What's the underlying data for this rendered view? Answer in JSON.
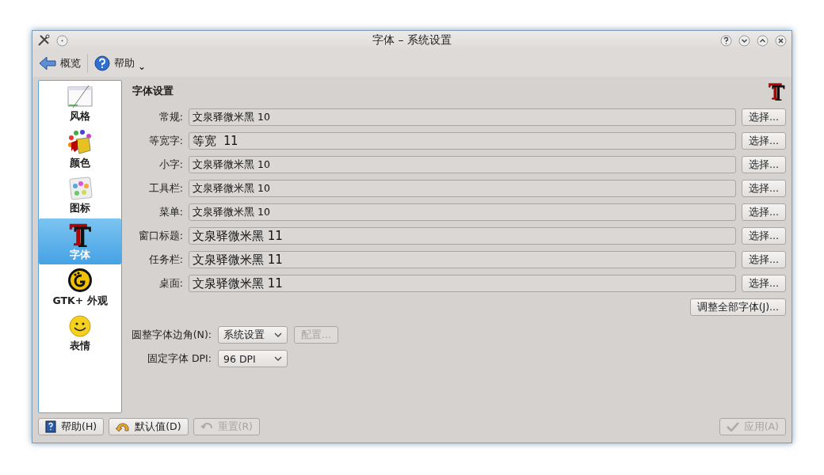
{
  "window": {
    "title": "字体 – 系统设置"
  },
  "toolbar": {
    "back": "概览",
    "help": "帮助",
    "help_menu": "⌄"
  },
  "sidebar": {
    "items": [
      {
        "label": "风格",
        "kind": "style",
        "selected": false
      },
      {
        "label": "颜色",
        "kind": "colors",
        "selected": false
      },
      {
        "label": "图标",
        "kind": "icons",
        "selected": false
      },
      {
        "label": "字体",
        "kind": "fonts",
        "selected": true
      },
      {
        "label": "GTK+ 外观",
        "kind": "gtk",
        "selected": false
      },
      {
        "label": "表情",
        "kind": "emoticons",
        "selected": false
      }
    ]
  },
  "section_title": "字体设置",
  "fonts": [
    {
      "label": "常规:",
      "value": "文泉驿微米黑 10",
      "kind": "proportional",
      "button": "选择..."
    },
    {
      "label": "等宽字:",
      "value": "等宽 11",
      "kind": "monospace",
      "button": "选择..."
    },
    {
      "label": "小字:",
      "value": "文泉驿微米黑 10",
      "kind": "proportional",
      "button": "选择..."
    },
    {
      "label": "工具栏:",
      "value": "文泉驿微米黑 10",
      "kind": "proportional",
      "button": "选择..."
    },
    {
      "label": "菜单:",
      "value": "文泉驿微米黑 10",
      "kind": "proportional",
      "button": "选择..."
    },
    {
      "label": "窗口标题:",
      "value": "文泉驿微米黑 11",
      "kind": "proportional",
      "button": "选择..."
    },
    {
      "label": "任务栏:",
      "value": "文泉驿微米黑 11",
      "kind": "proportional",
      "button": "选择..."
    },
    {
      "label": "桌面:",
      "value": "文泉驿微米黑 11",
      "kind": "proportional",
      "button": "选择..."
    }
  ],
  "adjust_all_button": "调整全部字体(J)...",
  "antialias": {
    "label": "圆整字体边角(N):",
    "value": "系统设置",
    "configure": {
      "label": "配置...",
      "disabled": true
    }
  },
  "dpi": {
    "label": "固定字体 DPI:",
    "value": "96 DPI"
  },
  "buttons": [
    {
      "label": "帮助(H)",
      "kind": "help",
      "disabled": false
    },
    {
      "label": "默认值(D)",
      "kind": "defaults",
      "disabled": false
    },
    {
      "label": "重置(R)",
      "kind": "reset",
      "disabled": true
    },
    {
      "label": "应用(A)",
      "kind": "apply",
      "disabled": true
    }
  ]
}
